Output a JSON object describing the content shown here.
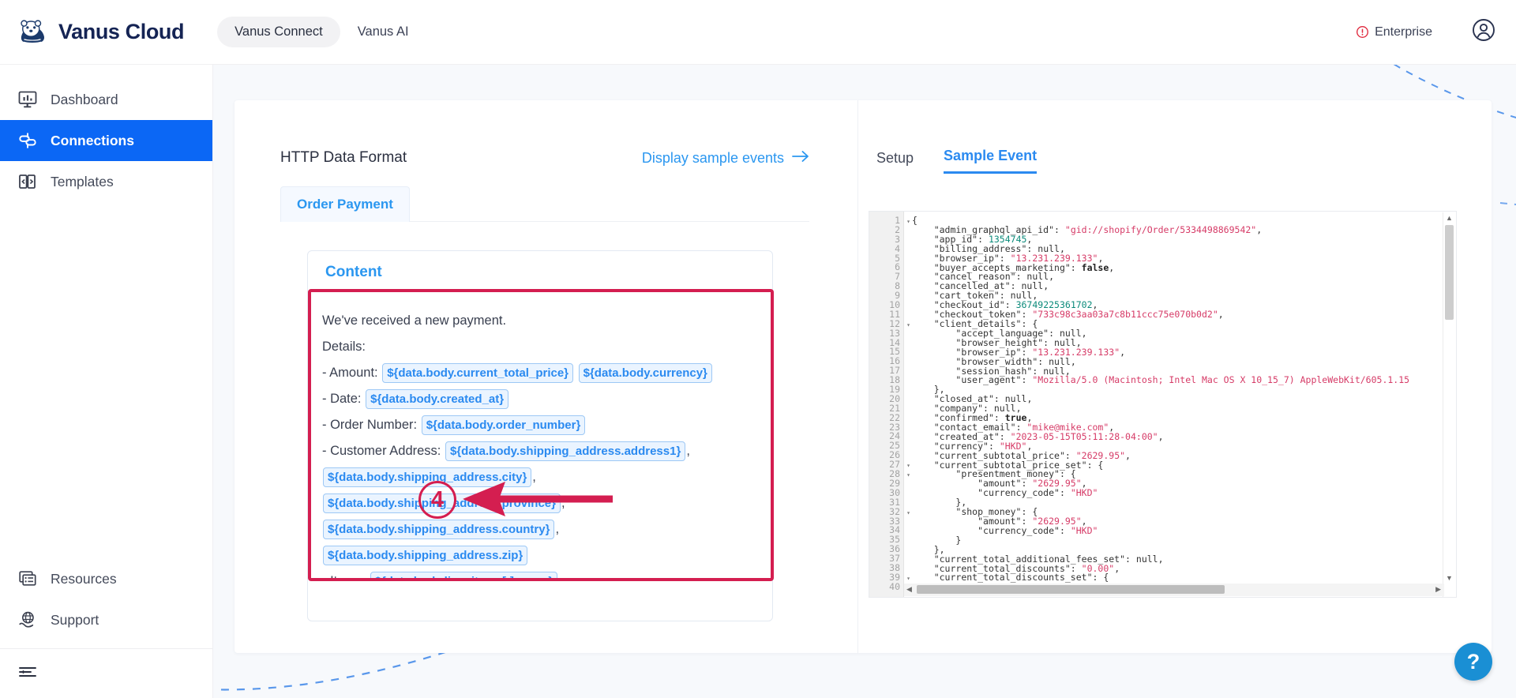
{
  "header": {
    "brand": "Vanus Cloud",
    "logo_icon": "otter-logo-icon",
    "tabs": [
      {
        "label": "Vanus Connect",
        "active": true
      },
      {
        "label": "Vanus AI",
        "active": false
      }
    ],
    "plan_label": "Enterprise",
    "plan_icon": "alert-circle-icon",
    "account_icon": "user-circle-icon"
  },
  "sidebar": {
    "items": [
      {
        "label": "Dashboard",
        "icon": "monitor-chart-icon",
        "active": false
      },
      {
        "label": "Connections",
        "icon": "connections-icon",
        "active": true
      },
      {
        "label": "Templates",
        "icon": "templates-icon",
        "active": false
      }
    ],
    "bottom_items": [
      {
        "label": "Resources",
        "icon": "resources-list-icon"
      },
      {
        "label": "Support",
        "icon": "support-globe-hand-icon"
      }
    ],
    "collapse_icon": "collapse-sidebar-icon"
  },
  "left_pane": {
    "title": "HTTP Data Format",
    "sample_link": "Display sample events",
    "sample_link_icon": "arrow-right-icon",
    "format_tabs": [
      {
        "label": "Order Payment",
        "active": true
      }
    ],
    "content_label": "Content",
    "template": {
      "line1": "We've received a new payment.",
      "line2": "Details:",
      "amount_label": "- Amount:",
      "amount_tokens": [
        "${data.body.current_total_price}",
        "${data.body.currency}"
      ],
      "date_label": "- Date:",
      "date_token": "${data.body.created_at}",
      "order_label": "- Order Number:",
      "order_token": "${data.body.order_number}",
      "address_label": "- Customer Address:",
      "address_tokens": [
        "${data.body.shipping_address.address1}",
        "${data.body.shipping_address.city}",
        "${data.body.shipping_address.province}",
        "${data.body.shipping_address.country}",
        "${data.body.shipping_address.zip}"
      ],
      "items_label": "- Items:",
      "items_token": "${data.body.line_items[:].name}"
    }
  },
  "right_pane": {
    "tabs": [
      {
        "label": "Setup",
        "active": false
      },
      {
        "label": "Sample Event",
        "active": true
      }
    ],
    "editor": {
      "first_line": 1,
      "last_line": 40,
      "line_numbers": [
        1,
        2,
        3,
        4,
        5,
        6,
        7,
        8,
        9,
        10,
        11,
        12,
        13,
        14,
        15,
        16,
        17,
        18,
        19,
        20,
        21,
        22,
        23,
        24,
        25,
        26,
        27,
        28,
        29,
        30,
        31,
        32,
        33,
        34,
        35,
        36,
        37,
        38,
        39,
        40
      ],
      "fold_lines": [
        1,
        12,
        27,
        28,
        32,
        39,
        40
      ],
      "code_lines": [
        "{",
        "    \"admin_graphql_api_id\": \"gid://shopify/Order/5334498869542\",",
        "    \"app_id\": 1354745,",
        "    \"billing_address\": null,",
        "    \"browser_ip\": \"13.231.239.133\",",
        "    \"buyer_accepts_marketing\": false,",
        "    \"cancel_reason\": null,",
        "    \"cancelled_at\": null,",
        "    \"cart_token\": null,",
        "    \"checkout_id\": 36749225361702,",
        "    \"checkout_token\": \"733c98c3aa03a7c8b11ccc75e070b0d2\",",
        "    \"client_details\": {",
        "        \"accept_language\": null,",
        "        \"browser_height\": null,",
        "        \"browser_ip\": \"13.231.239.133\",",
        "        \"browser_width\": null,",
        "        \"session_hash\": null,",
        "        \"user_agent\": \"Mozilla/5.0 (Macintosh; Intel Mac OS X 10_15_7) AppleWebKit/605.1.15",
        "    },",
        "    \"closed_at\": null,",
        "    \"company\": null,",
        "    \"confirmed\": true,",
        "    \"contact_email\": \"mike@mike.com\",",
        "    \"created_at\": \"2023-05-15T05:11:28-04:00\",",
        "    \"currency\": \"HKD\",",
        "    \"current_subtotal_price\": \"2629.95\",",
        "    \"current_subtotal_price_set\": {",
        "        \"presentment_money\": {",
        "            \"amount\": \"2629.95\",",
        "            \"currency_code\": \"HKD\"",
        "        },",
        "        \"shop_money\": {",
        "            \"amount\": \"2629.95\",",
        "            \"currency_code\": \"HKD\"",
        "        }",
        "    },",
        "    \"current_total_additional_fees_set\": null,",
        "    \"current_total_discounts\": \"0.00\",",
        "    \"current_total_discounts_set\": {"
      ]
    }
  },
  "annotation": {
    "marker": "4",
    "marker_color": "#d41e50"
  },
  "help": {
    "label": "?"
  },
  "colors": {
    "accent_blue": "#0b67f5",
    "link_blue": "#2b8af0",
    "annotation_red": "#d41e50",
    "brand_navy": "#152454",
    "canvas_bg": "#f7f9fc"
  }
}
